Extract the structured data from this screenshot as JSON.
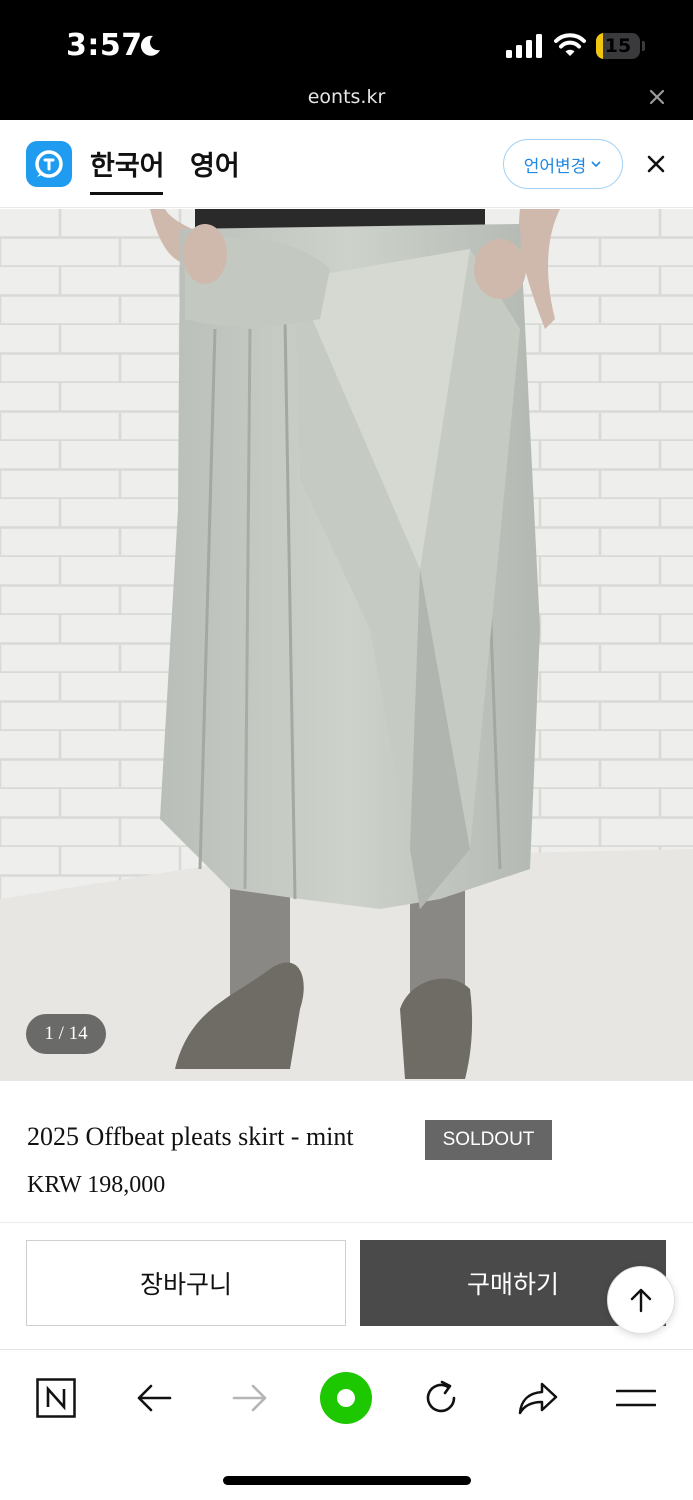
{
  "status_bar": {
    "time": "3:57",
    "battery": "15",
    "battery_level": 0.15,
    "url": "eonts.kr"
  },
  "translate_bar": {
    "tabs": [
      "한국어",
      "영어"
    ],
    "lang_change_label": "언어변경",
    "accent_color": "#1f9cf0"
  },
  "product": {
    "image_counter": "1 / 14",
    "title": "2025 Offbeat pleats skirt - mint",
    "status_badge": "SOLDOUT",
    "price": "KRW 198,000"
  },
  "actions": {
    "cart_label": "장바구니",
    "buy_label": "구매하기"
  },
  "toolbar": {
    "icons": [
      "naver-n-icon",
      "back-arrow-icon",
      "forward-arrow-icon",
      "green-dot-icon",
      "reload-icon",
      "share-icon",
      "menu-icon"
    ],
    "green_color": "#1ec800"
  }
}
